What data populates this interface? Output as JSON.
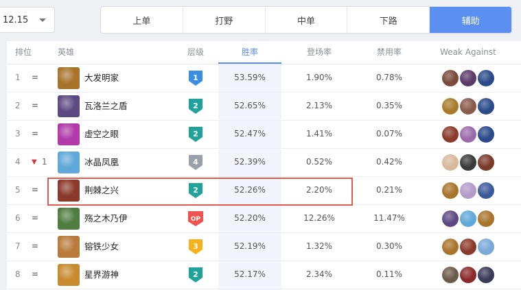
{
  "version": {
    "label": "12.15"
  },
  "roles": [
    "上单",
    "打野",
    "中单",
    "下路",
    "辅助"
  ],
  "active_role": "辅助",
  "colors": {
    "accent": "#5b8ff0",
    "highlight": "#e05a4f",
    "tier1": "#3a8ee6",
    "tier2": "#1fa39b",
    "tier3": "#f5b21a",
    "tier4": "#9aa0a8",
    "op": "#ef5350"
  },
  "headers": {
    "rank": "排位",
    "hero": "英雄",
    "tier": "层级",
    "win": "胜率",
    "pick": "登场率",
    "ban": "禁用率",
    "weak": "Weak Against"
  },
  "rows": [
    {
      "rank": "1",
      "trend": "=",
      "trend_delta": "",
      "name": "大发明家",
      "tier": "1",
      "win": "53.59%",
      "pick": "1.90%",
      "ban": "0.78%",
      "avatar_color": "#a8742c"
    },
    {
      "rank": "2",
      "trend": "=",
      "trend_delta": "",
      "name": "瓦洛兰之盾",
      "tier": "2",
      "win": "52.65%",
      "pick": "2.13%",
      "ban": "0.35%",
      "avatar_color": "#5b4a82"
    },
    {
      "rank": "3",
      "trend": "=",
      "trend_delta": "",
      "name": "虚空之眼",
      "tier": "2",
      "win": "52.47%",
      "pick": "1.41%",
      "ban": "0.07%",
      "avatar_color": "#b03aa8"
    },
    {
      "rank": "4",
      "trend": "▼",
      "trend_delta": "1",
      "name": "冰晶凤凰",
      "tier": "4",
      "win": "52.39%",
      "pick": "0.52%",
      "ban": "0.42%",
      "avatar_color": "#5fa8d8"
    },
    {
      "rank": "5",
      "trend": "=",
      "trend_delta": "",
      "name": "荆棘之兴",
      "tier": "2",
      "win": "52.26%",
      "pick": "2.20%",
      "ban": "0.21%",
      "avatar_color": "#8a3a2a"
    },
    {
      "rank": "6",
      "trend": "=",
      "trend_delta": "",
      "name": "殇之木乃伊",
      "tier": "OP",
      "win": "52.20%",
      "pick": "12.26%",
      "ban": "11.47%",
      "avatar_color": "#4f7d3f"
    },
    {
      "rank": "7",
      "trend": "=",
      "trend_delta": "",
      "name": "镕铁少女",
      "tier": "3",
      "win": "52.19%",
      "pick": "1.32%",
      "ban": "0.30%",
      "avatar_color": "#b97a3c"
    },
    {
      "rank": "8",
      "trend": "=",
      "trend_delta": "",
      "name": "星界游神",
      "tier": "2",
      "win": "52.17%",
      "pick": "2.34%",
      "ban": "0.11%",
      "avatar_color": "#c88a2e"
    }
  ],
  "weak_colors": [
    [
      "#7a4a3a",
      "#5a3a6a",
      "#2a4a8a"
    ],
    [
      "#a87a2a",
      "#8a5a4a",
      "#2a4a8a"
    ],
    [
      "#8a3a2a",
      "#9a6aaa",
      "#2a4a8a"
    ],
    [
      "#d8b89a",
      "#3a3a3a",
      "#7a3a2a"
    ],
    [
      "#a8742c",
      "#b49ac8",
      "#3a5a9a"
    ],
    [
      "#5b4a82",
      "#5fa8d8",
      "#a8742c"
    ],
    [
      "#a8742c",
      "#8a3a2a",
      "#7aa8d8"
    ],
    [
      "#6a5a4a",
      "#8a2a2a",
      "#3a3a5a"
    ]
  ]
}
